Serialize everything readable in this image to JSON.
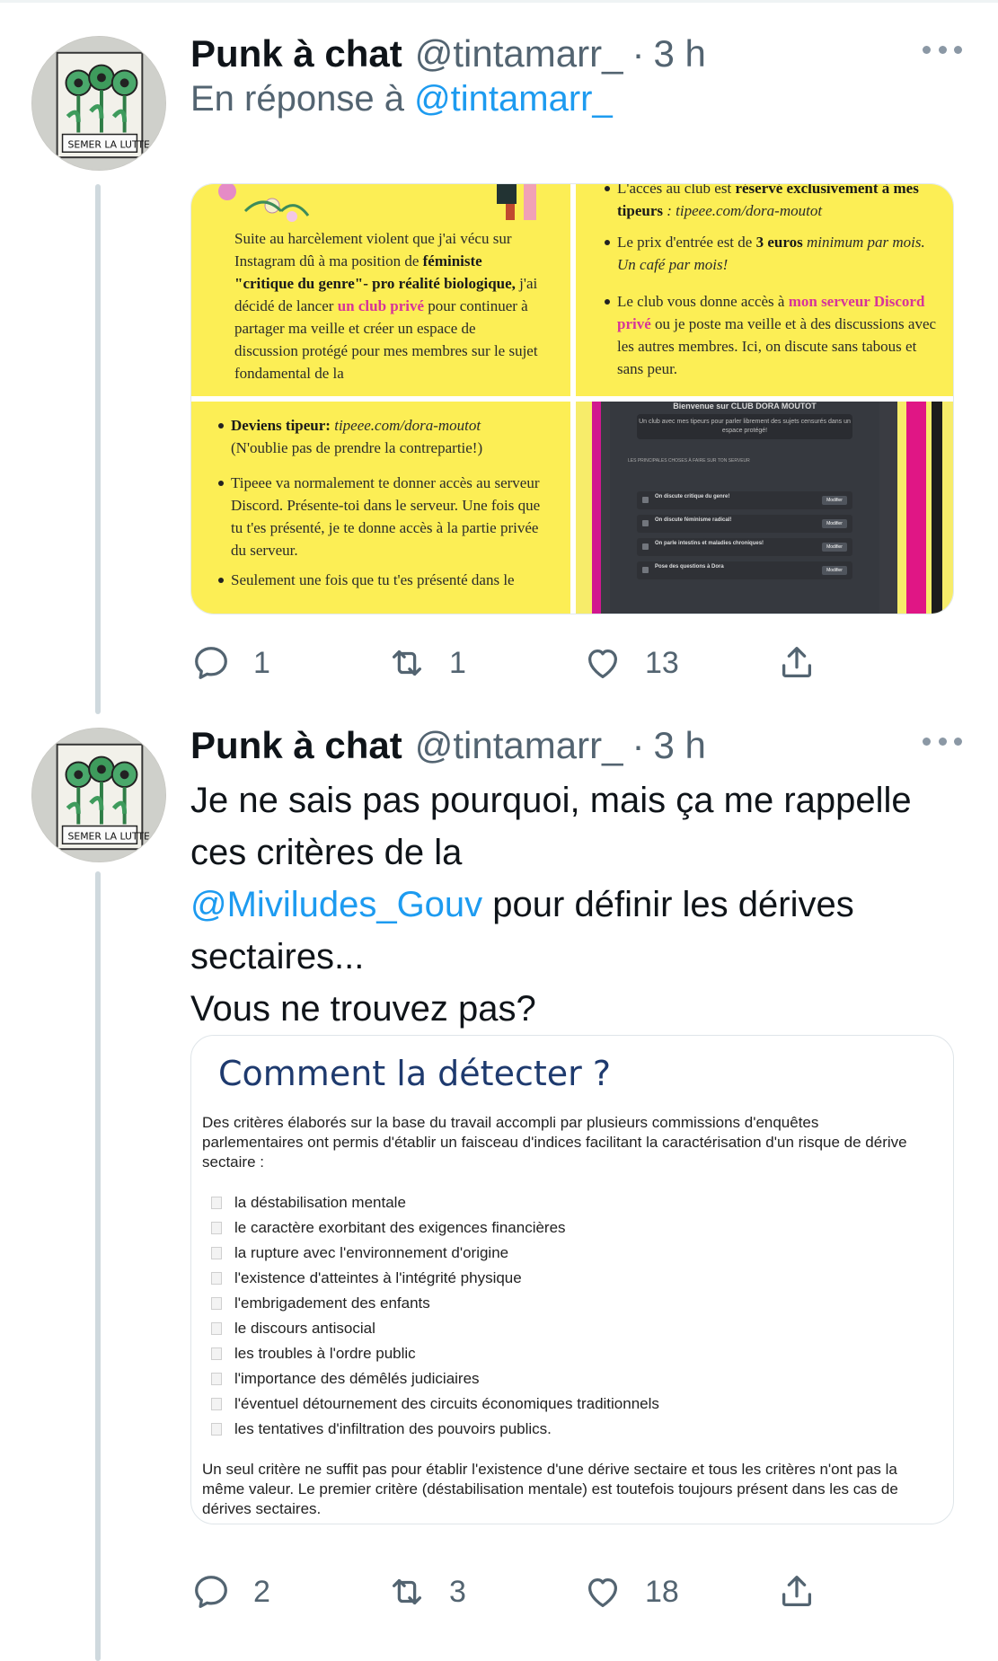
{
  "tweets": [
    {
      "author_name": "Punk à chat",
      "handle": "@tintamarr_",
      "separator": "·",
      "time": "3 h",
      "reply_prefix": "En réponse à",
      "reply_handle": "@tintamarr_",
      "media": {
        "tile1": {
          "text_before": "Suite au harcèlement violent que j'ai vécu sur Instagram dû à ma position de ",
          "bold1": "féministe \"critique du genre\"- pro réalité biologique,",
          "text_mid": " j'ai décidé de lancer ",
          "pink": "un club privé",
          "text_after": " pour continuer à partager ma veille et créer un espace de discussion protégé pour mes membres sur le sujet fondamental de la"
        },
        "tile2": {
          "b1_a": "L'accès au club est ",
          "b1_b": "réservé exclusivement à mes tipeurs",
          "b1_c": " : tipeee.com/dora-moutot",
          "b2_a": "Le prix d'entrée est de ",
          "b2_b": "3 euros",
          "b2_c": " minimum par mois. Un café par mois!",
          "b3_a": "Le club vous donne accès à ",
          "b3_b": "mon serveur Discord privé",
          "b3_c": " ou je poste ma veille et à des discussions avec les autres membres. Ici, on discute sans tabous et sans peur."
        },
        "tile3": {
          "b1_a": "Deviens tipeur: ",
          "b1_b": "tipeee.com/dora-moutot",
          "b1_c": "(N'oublie pas de prendre la contrepartie!)",
          "b2": "Tipeee va normalement te donner accès au serveur Discord. Présente-toi dans le serveur. Une fois que tu t'es présenté, je te donne accès à la partie privée du serveur.",
          "b3": "Seulement une fois que tu t'es présenté dans le"
        },
        "tile4": {
          "title": "Bienvenue sur CLUB DORA MOUTOT",
          "banner": "Un club avec mes tipeurs pour parler librement des sujets censurés dans un espace protégé!",
          "section": "LES PRINCIPALES CHOSES À FAIRE SUR TON SERVEUR",
          "rows": [
            {
              "label": "On discute critique du genre!",
              "button": "Modifier"
            },
            {
              "label": "On discute féminisme radical!",
              "button": "Modifier"
            },
            {
              "label": "On parle intestins et maladies chroniques!",
              "button": "Modifier"
            },
            {
              "label": "Pose des questions à Dora",
              "button": "Modifier"
            }
          ]
        }
      },
      "actions": {
        "replies": "1",
        "retweets": "1",
        "likes": "13"
      }
    },
    {
      "author_name": "Punk à chat",
      "handle": "@tintamarr_",
      "separator": "·",
      "time": "3 h",
      "text_line1": "Je ne sais pas pourquoi, mais ça me rappelle ces critères de la",
      "mention": "@Miviludes_Gouv",
      "text_line2": " pour définir les dérives sectaires...",
      "text_line3": "Vous ne trouvez pas?",
      "card": {
        "title": "Comment la détecter ?",
        "intro": "Des critères élaborés sur la base du travail accompli par plusieurs commissions d'enquêtes parlementaires ont permis d'établir un faisceau d'indices facilitant la caractérisation d'un risque de dérive sectaire :",
        "criteria": [
          "la déstabilisation mentale",
          "le caractère exorbitant des exigences financières",
          "la rupture avec l'environnement d'origine",
          "l'existence d'atteintes à l'intégrité physique",
          "l'embrigadement des enfants",
          "le discours antisocial",
          "les troubles à l'ordre public",
          "l'importance des démêlés judiciaires",
          "l'éventuel détournement des circuits économiques traditionnels",
          "les tentatives d'infiltration des pouvoirs publics."
        ],
        "footer": "Un seul critère ne suffit pas pour établir l'existence d'une dérive sectaire et tous les critères n'ont pas la même valeur. Le premier critère (déstabilisation mentale) est toutefois toujours présent dans les cas de dérives sectaires."
      },
      "actions": {
        "replies": "2",
        "retweets": "3",
        "likes": "18"
      }
    }
  ],
  "colors": {
    "accent": "#1d9bf0",
    "muted": "#536471",
    "thread": "#cfd9de",
    "media_yellow": "#fcee55",
    "pink": "#d6349a"
  },
  "icons": [
    "reply-icon",
    "retweet-icon",
    "like-icon",
    "share-icon",
    "more-icon"
  ]
}
